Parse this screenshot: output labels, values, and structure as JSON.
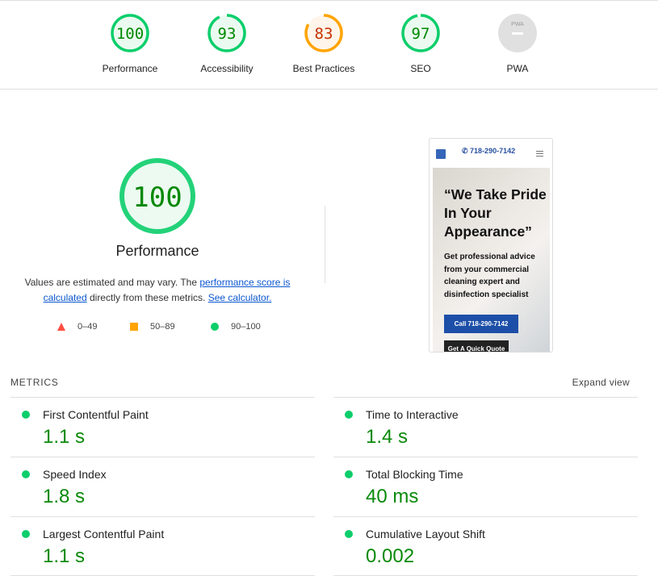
{
  "colors": {
    "pass": "#0cce6b",
    "pass_text": "#008800",
    "average": "#ffa400",
    "average_text": "#c33300",
    "fail": "#ff4e42",
    "na": "#e0e0e0"
  },
  "categories": [
    {
      "label": "Performance",
      "score": "100",
      "status": "pass"
    },
    {
      "label": "Accessibility",
      "score": "93",
      "status": "pass"
    },
    {
      "label": "Best Practices",
      "score": "83",
      "status": "average"
    },
    {
      "label": "SEO",
      "score": "97",
      "status": "pass"
    },
    {
      "label": "PWA",
      "score": "",
      "status": "na",
      "badge": "PWA"
    }
  ],
  "main": {
    "score": "100",
    "title": "Performance",
    "desc_1": "Values are estimated and may vary. The ",
    "link_1": "performance score is calculated",
    "desc_2": " directly from these metrics. ",
    "link_2": "See calculator.",
    "legend": [
      {
        "icon": "triangle",
        "range": "0–49"
      },
      {
        "icon": "square",
        "range": "50–89"
      },
      {
        "icon": "circle",
        "range": "90–100"
      }
    ]
  },
  "screenshot": {
    "phone": "718-290-7142",
    "headline": "“We Take Pride In Your Appearance”",
    "sub": "Get professional advice from your commercial cleaning expert and disinfection specialist",
    "cta": "Call 718-290-7142",
    "quote": "Get A Quick Quote"
  },
  "metrics": {
    "heading": "METRICS",
    "expand": "Expand view",
    "left": [
      {
        "label": "First Contentful Paint",
        "value": "1.1 s"
      },
      {
        "label": "Speed Index",
        "value": "1.8 s"
      },
      {
        "label": "Largest Contentful Paint",
        "value": "1.1 s"
      }
    ],
    "right": [
      {
        "label": "Time to Interactive",
        "value": "1.4 s"
      },
      {
        "label": "Total Blocking Time",
        "value": "40 ms"
      },
      {
        "label": "Cumulative Layout Shift",
        "value": "0.002"
      }
    ]
  }
}
